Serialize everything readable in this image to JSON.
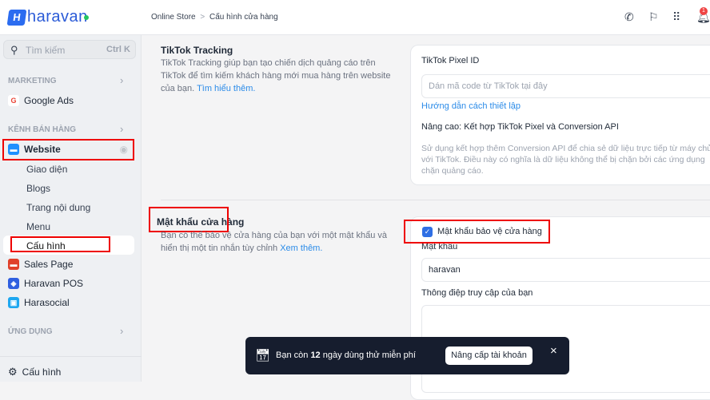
{
  "brand": {
    "name": "haravan"
  },
  "search": {
    "placeholder": "Tìm kiếm",
    "shortcut": "Ctrl K"
  },
  "sidebar": {
    "marketing_label": "MARKETING",
    "google_ads": "Google Ads",
    "sales_channels_label": "KÊNH BÁN HÀNG",
    "website": "Website",
    "website_sub": [
      "Giao diện",
      "Blogs",
      "Trang nội dung",
      "Menu",
      "Cấu hình"
    ],
    "sales_page": "Sales Page",
    "pos": "Haravan POS",
    "harasocial": "Harasocial",
    "apps_label": "ỨNG DỤNG",
    "settings": "Cấu hình"
  },
  "breadcrumb": {
    "parent": "Online Store",
    "separator": ">",
    "current": "Cấu hình cửa hàng"
  },
  "notifications": {
    "count": "1"
  },
  "tiktok": {
    "title": "TikTok Tracking",
    "description": "TikTok Tracking giúp bạn tạo chiến dịch quảng cáo trên TikTok để tìm kiếm khách hàng mới mua hàng trên website của bạn.",
    "learn_more": "Tìm hiểu thêm.",
    "pixel_label": "TikTok Pixel ID",
    "pixel_placeholder": "Dán mã code từ TikTok tại đây",
    "guide_link": "Hướng dẫn cách thiết lập",
    "advanced_title": "Nâng cao: Kết hợp TikTok Pixel và Conversion API",
    "advanced_desc": "Sử dụng kết hợp thêm Conversion API để chia sẻ dữ liệu trực tiếp từ máy chủ với TikTok. Điều này có nghĩa là dữ liệu không thể bị chặn bởi các ứng dụng chặn quảng cáo."
  },
  "password": {
    "title": "Mật khẩu cửa hàng",
    "description": "Bạn có thể bảo vệ cửa hàng của bạn với một mật khẩu và hiển thị một tin nhắn tùy chỉnh",
    "learn_more": "Xem thêm.",
    "checkbox_label": "Mật khẩu bảo vệ cửa hàng",
    "checkbox_checked": true,
    "password_label": "Mật khẩu",
    "password_value": "haravan",
    "message_label": "Thông điệp truy cập của bạn",
    "message_value": ""
  },
  "toast": {
    "prefix": "Bạn còn",
    "days": "12",
    "suffix": "ngày dùng thử miễn phí",
    "upgrade": "Nâng cấp tài khoản",
    "close": "×"
  }
}
